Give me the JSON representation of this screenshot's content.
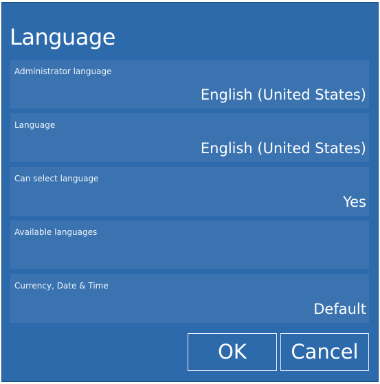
{
  "dialog": {
    "title": "Language"
  },
  "rows": [
    {
      "label": "Administrator language",
      "value": "English (United States)"
    },
    {
      "label": "Language",
      "value": "English (United States)"
    },
    {
      "label": "Can select language",
      "value": "Yes"
    },
    {
      "label": "Available languages",
      "value": ""
    },
    {
      "label": "Currency, Date & Time",
      "value": "Default"
    }
  ],
  "buttons": {
    "ok_label": "OK",
    "cancel_label": "Cancel"
  },
  "colors": {
    "dialog_background": "#2c6aab",
    "row_background": "#3a73b0",
    "text": "#ffffff"
  }
}
